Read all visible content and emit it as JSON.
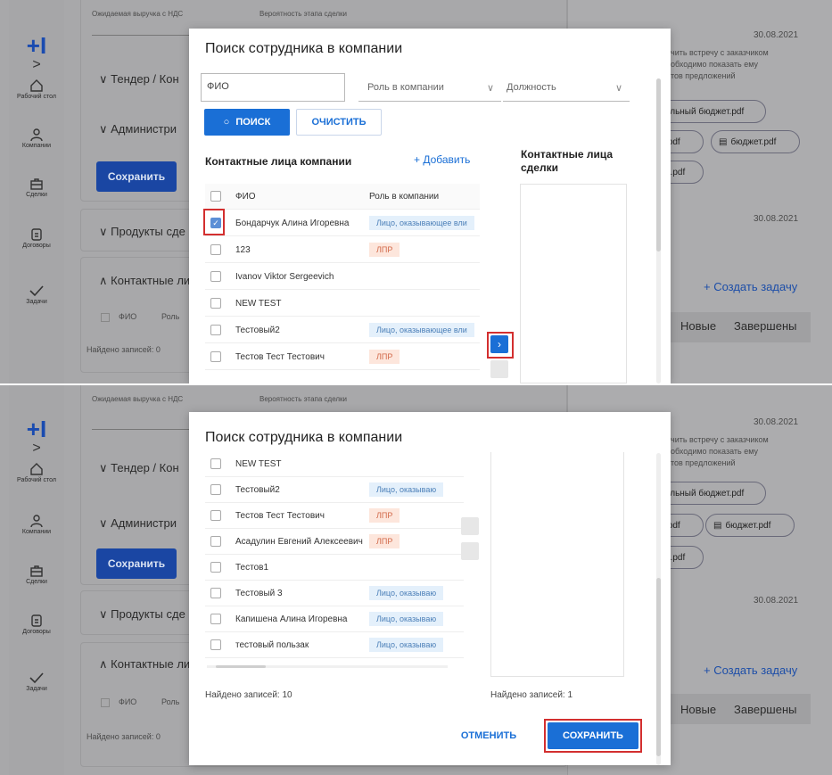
{
  "sidebar": {
    "logo": "+I",
    "expand": ">",
    "items": [
      {
        "label": "Рабочий стол",
        "icon": "home-icon"
      },
      {
        "label": "Компании",
        "icon": "people-icon"
      },
      {
        "label": "Сделки",
        "icon": "briefcase-icon"
      },
      {
        "label": "Договоры",
        "icon": "document-icon"
      },
      {
        "label": "Задачи",
        "icon": "check-icon"
      }
    ]
  },
  "background": {
    "revenue_label": "Ожидаемая выручка с НДС",
    "probability_label": "Вероятность этапа сделки",
    "tender_section": "Тендер / Кон",
    "admin_section": "Администри",
    "save_button": "Сохранить",
    "products_section": "Продукты сде",
    "contacts_section": "Контактные ли",
    "col_fio": "ФИО",
    "col_role": "Роль",
    "found_records": "Найдено записей: 0",
    "right": {
      "date1": "30.08.2021",
      "date2": "30.08.2021",
      "task_lines": [
        "чить встречу с заказчиком",
        "обходимо показать ему",
        "тов предложений"
      ],
      "files": [
        "ельный бюджет.pdf",
        ".pdf",
        "бюджет.pdf",
        "5.pdf"
      ],
      "create_task": "+ Создать задачу",
      "tab_new": "Новые",
      "tab_done": "Завершены"
    }
  },
  "modal_top": {
    "title": "Поиск сотрудника в компании",
    "fio_placeholder": "ФИО",
    "role_placeholder": "Роль в компании",
    "position_placeholder": "Должность",
    "search_button": "ПОИСК",
    "clear_button": "ОЧИСТИТЬ",
    "company_contacts_title": "Контактные лица компании",
    "add_button": "+ Добавить",
    "deal_contacts_title": "Контактные лица сделки",
    "col_fio": "ФИО",
    "col_role": "Роль в компании",
    "rows": [
      {
        "name": "Бондарчук Алина Игоревна",
        "role": "Лицо, оказывающее вли",
        "role_type": "blue",
        "checked": true
      },
      {
        "name": "123",
        "role": "ЛПР",
        "role_type": "orange",
        "checked": false
      },
      {
        "name": "Ivanov Viktor Sergeevich",
        "role": "",
        "role_type": "",
        "checked": false
      },
      {
        "name": "NEW TEST",
        "role": "",
        "role_type": "",
        "checked": false
      },
      {
        "name": "Тестовый2",
        "role": "Лицо, оказывающее вли",
        "role_type": "blue",
        "checked": false
      },
      {
        "name": "Тестов Тест Тестович",
        "role": "ЛПР",
        "role_type": "orange",
        "checked": false
      }
    ],
    "move_arrow": "›"
  },
  "modal_bottom": {
    "title": "Поиск сотрудника в компании",
    "rows": [
      {
        "name": "NEW TEST",
        "role": "",
        "role_type": ""
      },
      {
        "name": "Тестовый2",
        "role": "Лицо, оказываю",
        "role_type": "blue"
      },
      {
        "name": "Тестов Тест Тестович",
        "role": "ЛПР",
        "role_type": "orange"
      },
      {
        "name": "Асадулин Евгений Алексеевич",
        "role": "ЛПР",
        "role_type": "orange"
      },
      {
        "name": "Тестов1",
        "role": "",
        "role_type": ""
      },
      {
        "name": "Тестовый 3",
        "role": "Лицо, оказываю",
        "role_type": "blue"
      },
      {
        "name": "Капишена Алина Игоревна",
        "role": "Лицо, оказываю",
        "role_type": "blue"
      },
      {
        "name": "тестовый пользак",
        "role": "Лицо, оказываю",
        "role_type": "blue"
      }
    ],
    "found_left": "Найдено записей: 10",
    "found_right": "Найдено записей: 1",
    "cancel_button": "ОТМЕНИТЬ",
    "save_button": "СОХРАНИТЬ"
  },
  "colors": {
    "primary": "#1a6fd6",
    "highlight": "#d32f2f",
    "overlay": "#a8a8aa"
  }
}
